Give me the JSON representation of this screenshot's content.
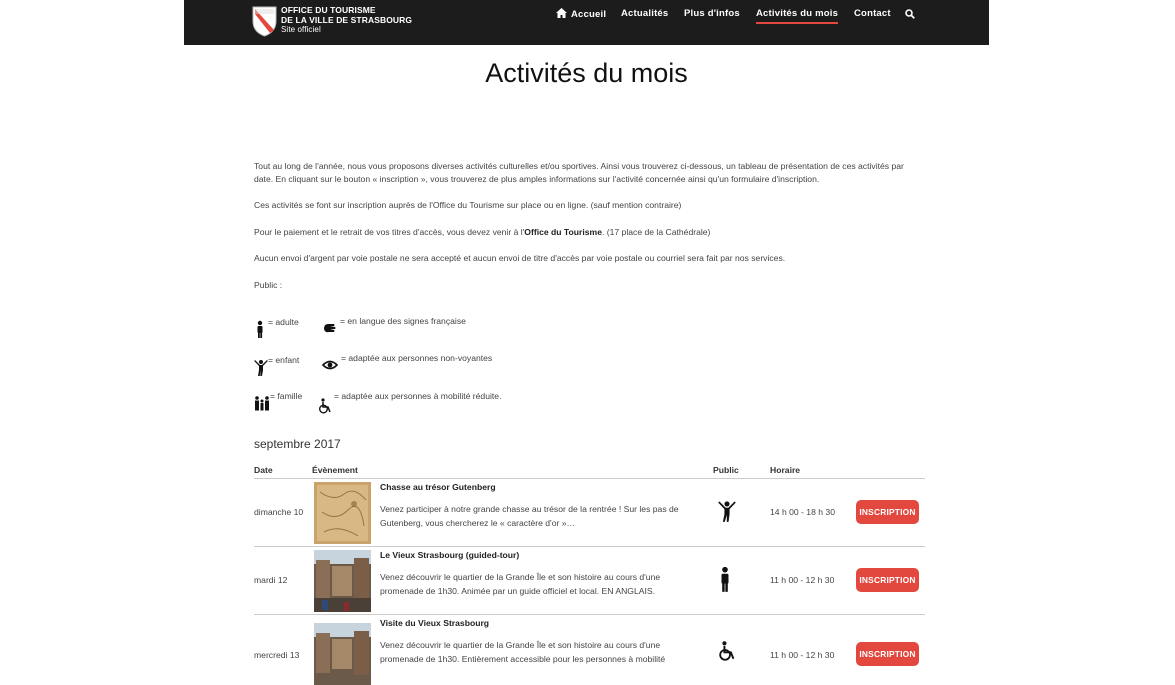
{
  "brand": {
    "line1": "OFFICE DU TOURISME",
    "line2": "DE LA VILLE DE STRASBOURG",
    "line3": "Site officiel",
    "accent": "#e2483e"
  },
  "nav": {
    "items": [
      {
        "label": "Accueil",
        "icon": "home-icon"
      },
      {
        "label": "Actualités"
      },
      {
        "label": "Plus d'infos"
      },
      {
        "label": "Activités du mois",
        "active": true
      },
      {
        "label": "Contact"
      }
    ],
    "search_icon": "search-icon"
  },
  "page": {
    "title": "Activités du mois",
    "intro1": "Tout au long de l'année, nous vous proposons diverses activités culturelles et/ou sportives. Ainsi vous trouverez ci-dessous, un tableau de présentation de ces activités par date. En cliquant  sur le bouton « inscription », vous trouverez de plus amples informations sur l'activité concernée ainsi qu'un formulaire d'inscription.",
    "intro2": "Ces activités se font sur inscription auprès de l'Office du Tourisme sur place ou en ligne. (sauf mention contraire)",
    "intro3_a": "Pour le paiement et le retrait de vos titres d'accès, vous devez venir à l'",
    "intro3_b": "Office du Tourisme",
    "intro3_c": ".  (17 place de la Cathédrale)",
    "intro4": "Aucun envoi d'argent par voie postale ne sera accepté et aucun envoi de titre d'accès par voie postale ou courriel sera fait par nos services.",
    "public_label": "Public :"
  },
  "legend": [
    {
      "icon": "adult-icon",
      "text": "= adulte"
    },
    {
      "icon": "sign-language-icon",
      "text": "= en langue des signes française"
    },
    {
      "icon": "child-icon",
      "text": "= enfant"
    },
    {
      "icon": "eye-icon",
      "text": "= adaptée aux personnes non-voyantes"
    },
    {
      "icon": "family-icon",
      "text": "= famille"
    },
    {
      "icon": "wheelchair-icon",
      "text": "= adaptée aux personnes à mobilité réduite."
    }
  ],
  "table": {
    "month": "septembre 2017",
    "headers": {
      "date": "Date",
      "event": "Évènement",
      "public": "Public",
      "hours": "Horaire"
    },
    "rows": [
      {
        "date": "dimanche 10",
        "title": "Chasse au trésor Gutenberg",
        "desc": "Venez participer à notre grande chasse au trésor de la rentrée ! Sur les pas de Gutenberg, vous chercherez le « caractère d'or »…",
        "public_icon": "child-icon",
        "hours": "14 h 00 - 18 h 30",
        "button": "INSCRIPTION"
      },
      {
        "date": "mardi 12",
        "title": "Le Vieux Strasbourg (guided-tour)",
        "desc": "Venez découvrir le quartier de la Grande Île et son histoire au cours d'une promenade de 1h30. Animée par un guide officiel et local. EN ANGLAIS.",
        "public_icon": "adult-icon",
        "hours": "11 h 00 - 12 h 30",
        "button": "INSCRIPTION"
      },
      {
        "date": "mercredi 13",
        "title": "Visite du Vieux Strasbourg",
        "desc": "Venez découvrir le quartier de la Grande Île et son histoire au cours d'une promenade de 1h30. Entièrement accessible pour les personnes à mobilité",
        "public_icon": "wheelchair-icon",
        "hours": "11 h 00 - 12 h 30",
        "button": "INSCRIPTION"
      }
    ]
  }
}
